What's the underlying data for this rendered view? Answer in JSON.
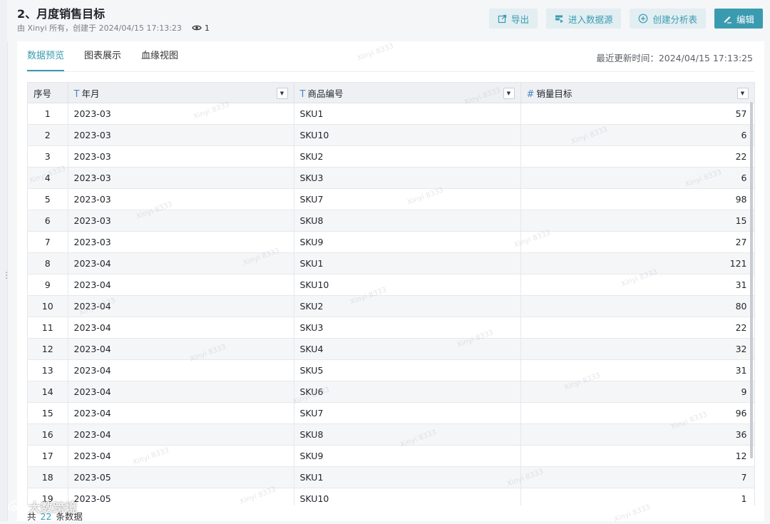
{
  "header": {
    "title": "2、月度销售目标",
    "meta": "由 Xinyi 所有，创建于 2024/04/15 17:13:23",
    "views": "1"
  },
  "actions": {
    "export": "导出",
    "enter_datasource": "进入数据源",
    "create_analysis": "创建分析表",
    "edit": "编辑"
  },
  "tabs": [
    "数据预览",
    "图表展示",
    "血缘视图"
  ],
  "update_time": "最近更新时间：2024/04/15 17:13:25",
  "table": {
    "columns": [
      "序号",
      "年月",
      "商品编号",
      "销量目标"
    ],
    "column_types": [
      "",
      "T",
      "T",
      "#"
    ],
    "rows": [
      [
        "1",
        "2023-03",
        "SKU1",
        "57"
      ],
      [
        "2",
        "2023-03",
        "SKU10",
        "6"
      ],
      [
        "3",
        "2023-03",
        "SKU2",
        "22"
      ],
      [
        "4",
        "2023-03",
        "SKU3",
        "6"
      ],
      [
        "5",
        "2023-03",
        "SKU7",
        "98"
      ],
      [
        "6",
        "2023-03",
        "SKU8",
        "15"
      ],
      [
        "7",
        "2023-03",
        "SKU9",
        "27"
      ],
      [
        "8",
        "2023-04",
        "SKU1",
        "121"
      ],
      [
        "9",
        "2023-04",
        "SKU10",
        "31"
      ],
      [
        "10",
        "2023-04",
        "SKU2",
        "80"
      ],
      [
        "11",
        "2023-04",
        "SKU3",
        "22"
      ],
      [
        "12",
        "2023-04",
        "SKU4",
        "32"
      ],
      [
        "13",
        "2023-04",
        "SKU5",
        "31"
      ],
      [
        "14",
        "2023-04",
        "SKU6",
        "9"
      ],
      [
        "15",
        "2023-04",
        "SKU7",
        "96"
      ],
      [
        "16",
        "2023-04",
        "SKU8",
        "36"
      ],
      [
        "17",
        "2023-04",
        "SKU9",
        "12"
      ],
      [
        "18",
        "2023-05",
        "SKU1",
        "7"
      ],
      [
        "19",
        "2023-05",
        "SKU10",
        "1"
      ]
    ]
  },
  "footer": {
    "prefix": "共",
    "count": "22",
    "suffix": "条数据"
  },
  "brand": "大数跨境",
  "watermark": "Xinyi 8333",
  "colors": {
    "accent": "#3a9bb0",
    "accent_light_bg": "#e2eef2",
    "type_icon": "#4a86c5"
  }
}
